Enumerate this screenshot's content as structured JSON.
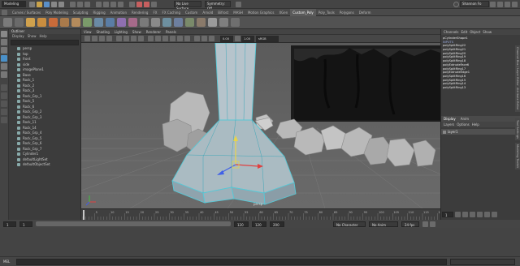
{
  "status_line": {
    "menuset": "Modeling",
    "live_surface": "No Live Surface",
    "symmetry": "Symmetry: Off",
    "user": "Shannon Fo"
  },
  "shelf_tabs": [
    "Curves / Surfaces",
    "Poly Modeling",
    "Sculpting",
    "Rigging",
    "Animation",
    "Rendering",
    "FX",
    "FX Caching",
    "Custom",
    "Arnold",
    "Bifrost",
    "MASH",
    "Motion Graphics",
    "XGen",
    "Custom_Poly",
    "Poly_Tools",
    "Polygons",
    "Deform"
  ],
  "shelf_active": "Custom_Poly",
  "outliner": {
    "title": "Outliner",
    "menu": [
      "Display",
      "Show",
      "Help"
    ],
    "items": [
      {
        "label": "persp"
      },
      {
        "label": "top"
      },
      {
        "label": "front"
      },
      {
        "label": "side"
      },
      {
        "label": "imagePlane1"
      },
      {
        "label": "Base"
      },
      {
        "label": "Rock_1"
      },
      {
        "label": "Rock_2"
      },
      {
        "label": "Rock_3"
      },
      {
        "label": "Rock_Grp_1"
      },
      {
        "label": "Rock_5"
      },
      {
        "label": "Rock_6"
      },
      {
        "label": "Rock_Grp_2"
      },
      {
        "label": "Rock_Grp_3"
      },
      {
        "label": "Rock_11"
      },
      {
        "label": "Rock_14"
      },
      {
        "label": "Rock_Grp_4"
      },
      {
        "label": "Rock_Grp_5"
      },
      {
        "label": "Rock_Grp_6"
      },
      {
        "label": "Rock_Grp_7"
      },
      {
        "label": "Cylinder1"
      },
      {
        "label": "defaultLightSet"
      },
      {
        "label": "defaultObjectSet"
      }
    ]
  },
  "viewport_menu": [
    "View",
    "Shading",
    "Lighting",
    "Show",
    "Renderer",
    "Panels"
  ],
  "viewport_fields": {
    "near": "0.00",
    "far": "1.00",
    "colorspace": "sRGB gamma"
  },
  "viewport_label": "persp",
  "channel_box": {
    "menu": [
      "Channels",
      "Edit",
      "Object",
      "Show"
    ],
    "items": [
      "pCylinderShape1",
      "INPUTS",
      "polySplitRing22",
      "polySplitRing21",
      "polySplitRing20",
      "polySplitRing19",
      "polySplitRing18",
      "polyExtrudeFace6",
      "polySplitRing17",
      "polyExtrudeEdge1",
      "polySplitRing16",
      "polySplitRing15",
      "polySplitRing14",
      "polySplitRing13"
    ],
    "display_tabs": [
      "Display",
      "Anim"
    ],
    "layer_menu": [
      "Layers",
      "Options",
      "Help"
    ],
    "layer_name": "layer1",
    "side_tabs": [
      "Channel Box / Layer Editor",
      "Attribute Editor",
      "Tool Settings",
      "Modeling Toolkit"
    ]
  },
  "timeline": {
    "ticks": [
      "5",
      "10",
      "15",
      "20",
      "25",
      "30",
      "35",
      "40",
      "45",
      "50",
      "55",
      "60",
      "65",
      "70",
      "75",
      "80",
      "85",
      "90",
      "95",
      "100",
      "105",
      "110",
      "115",
      "120"
    ],
    "current_frame": "1",
    "start": "1",
    "range_start": "1",
    "range_end": "120",
    "end": "120",
    "max": "200",
    "character_set": "No Character Set",
    "anim_layer": "No Anim Layer",
    "fps": "24 fps"
  },
  "command_line": {
    "lang": "MEL"
  },
  "colors": {
    "accent": "#5fb7c7",
    "selection": "#57c8d6",
    "sky": "#5e5e5e"
  }
}
